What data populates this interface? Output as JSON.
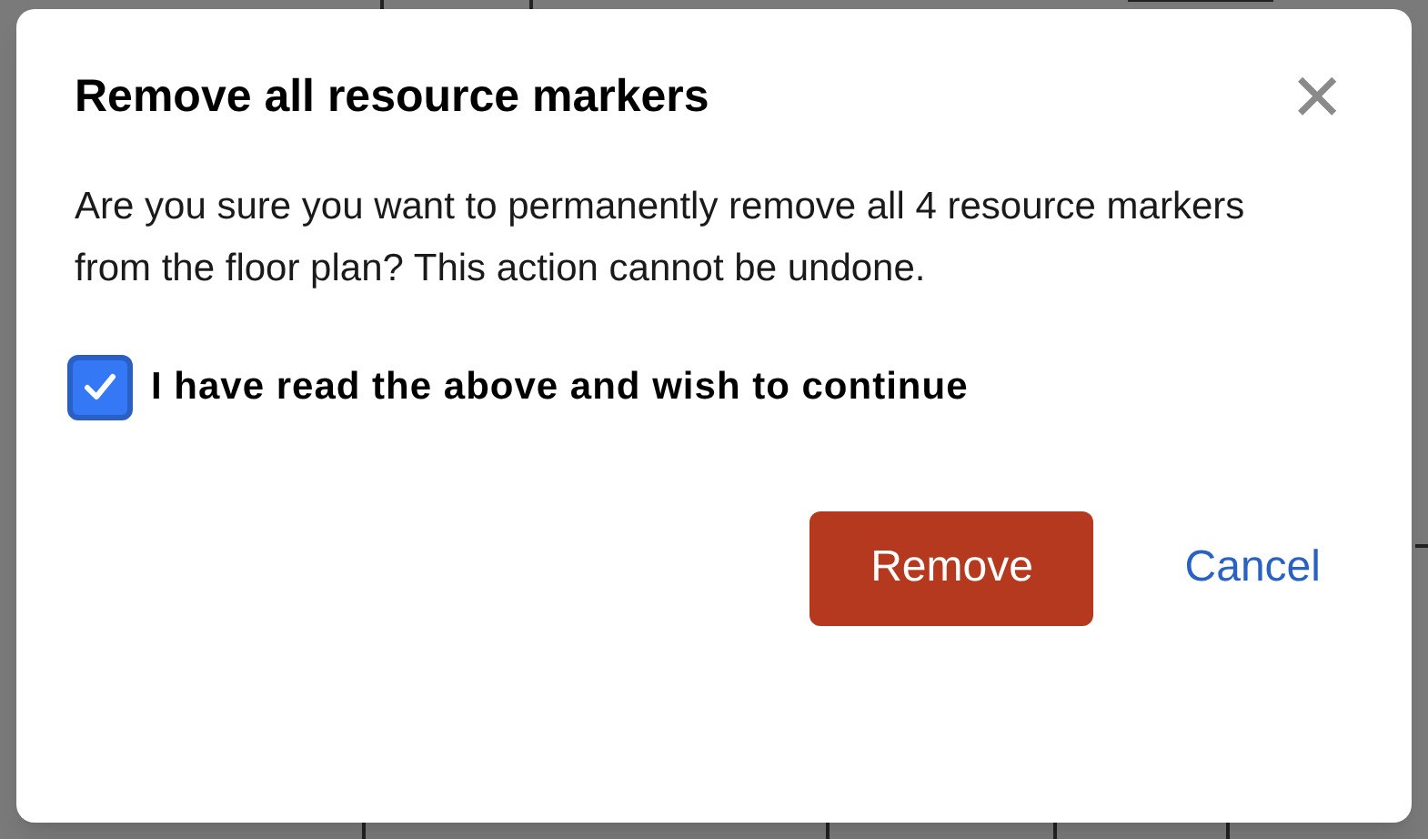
{
  "dialog": {
    "title": "Remove all resource markers",
    "close_label": "✕",
    "message": "Are you sure you want to permanently remove all 4 resource markers from the floor plan? This action cannot be undone.",
    "confirmation": {
      "label": "I have read the above and wish to continue",
      "checked": true
    },
    "buttons": [
      {
        "kind": "primary",
        "label": "Remove"
      },
      {
        "kind": "link",
        "label": "Cancel"
      }
    ]
  }
}
